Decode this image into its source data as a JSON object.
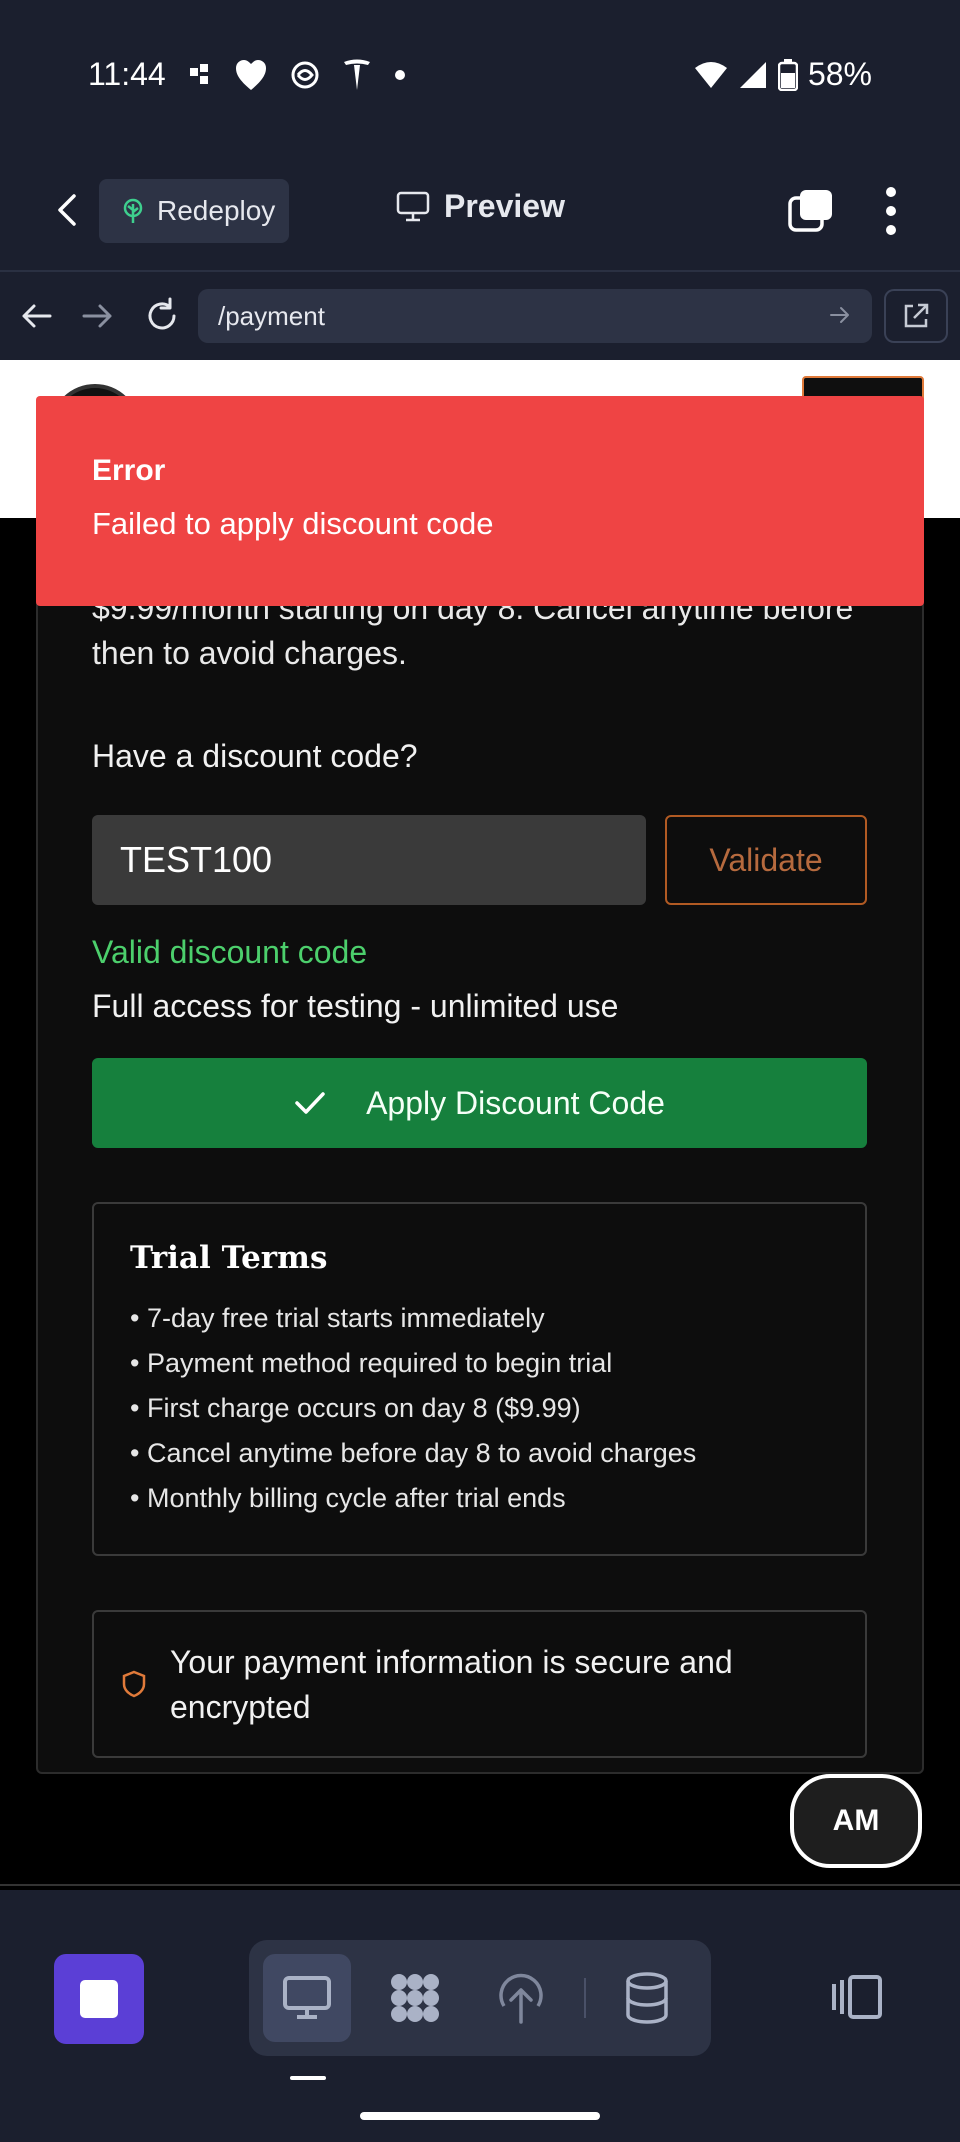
{
  "status_bar": {
    "time": "11:44",
    "battery": "58%",
    "icons": [
      "notification-dots-icon",
      "heart-shield-icon",
      "swirl-icon",
      "tesla-icon",
      "dot-icon",
      "wifi-icon",
      "signal-icon",
      "battery-icon"
    ]
  },
  "app_header": {
    "redeploy_label": "Redeploy",
    "preview_label": "Preview"
  },
  "browser": {
    "url": "/payment"
  },
  "page": {
    "trial_text": "$9.99/month starting on day 8. Cancel anytime before then to avoid charges.",
    "discount_label": "Have a discount code?",
    "code_value": "TEST100",
    "validate_label": "Validate",
    "valid_message": "Valid discount code",
    "access_message": "Full access for testing - unlimited use",
    "apply_label": "Apply Discount Code",
    "terms": {
      "title": "Trial Terms",
      "items": [
        "• 7-day free trial starts immediately",
        "• Payment method required to begin trial",
        "• First charge occurs on day 8 ($9.99)",
        "• Cancel anytime before day 8 to avoid charges",
        "• Monthly billing cycle after trial ends"
      ]
    },
    "secure_text": "Your payment information is secure and encrypted",
    "avatar_initials": "AM"
  },
  "toast": {
    "title": "Error",
    "message": "Failed to apply discount code"
  },
  "colors": {
    "error": "#ef4444",
    "success": "#4ccf6c",
    "apply_button": "#16803d",
    "accent_orange": "#b15a23",
    "stop_button": "#5b3fd6"
  }
}
